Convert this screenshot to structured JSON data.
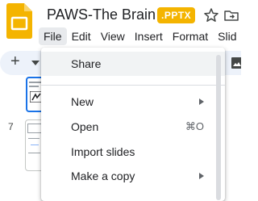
{
  "document": {
    "title": "PAWS-The Brain",
    "extension_badge": ".PPTX",
    "badge_color": "#f4b400"
  },
  "icons": {
    "app": "google-slides-icon",
    "star": "star-icon",
    "move": "move-to-folder-icon",
    "add": "plus-icon",
    "image": "image-icon"
  },
  "menubar": {
    "items": [
      "File",
      "Edit",
      "View",
      "Insert",
      "Format",
      "Slid"
    ]
  },
  "toolbar": {
    "add_label": "+"
  },
  "filmstrip": {
    "slide_number": "7"
  },
  "file_menu": {
    "items": [
      {
        "label": "Share",
        "shortcut": "",
        "submenu": false
      },
      {
        "label": "New",
        "shortcut": "",
        "submenu": true
      },
      {
        "label": "Open",
        "shortcut": "⌘O",
        "submenu": false
      },
      {
        "label": "Import slides",
        "shortcut": "",
        "submenu": false
      },
      {
        "label": "Make a copy",
        "shortcut": "",
        "submenu": true
      }
    ]
  }
}
